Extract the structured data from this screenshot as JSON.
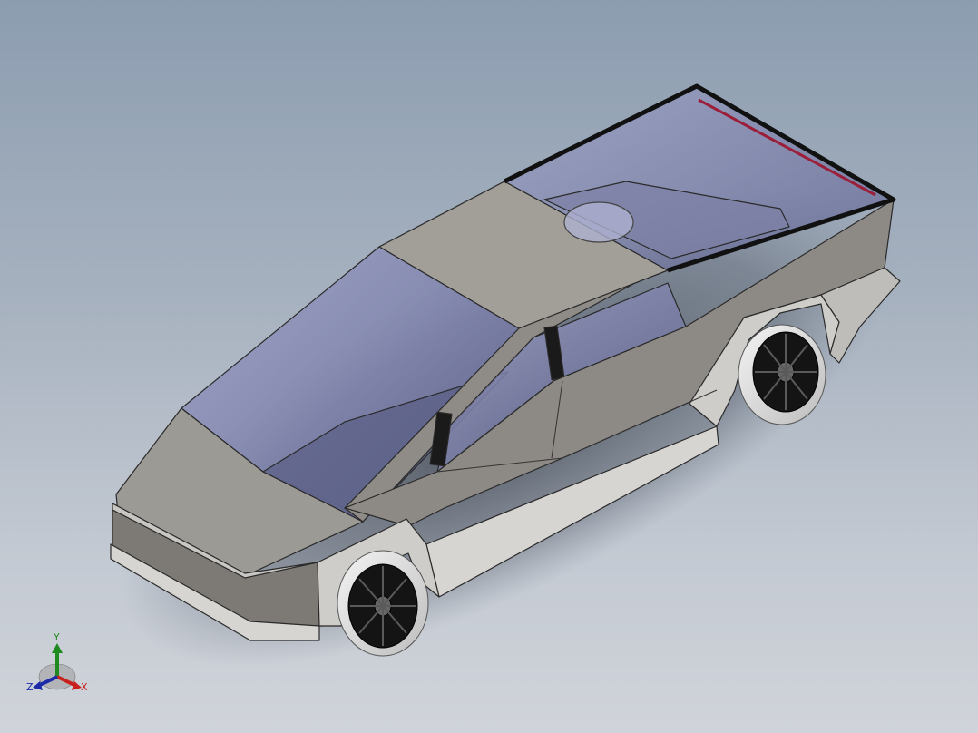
{
  "viewport": {
    "background_top": "#8c9db0",
    "background_bottom": "#d0d4da"
  },
  "model": {
    "body_color": "#a3a19c",
    "glass_color": "#6f73a3",
    "tire_color": "#d9d9d9",
    "hub_color": "#111111",
    "tailgate_accent": "#9b1f3a"
  },
  "triad": {
    "x_label": "X",
    "y_label": "Y",
    "z_label": "Z",
    "x_color": "#c8201c",
    "y_color": "#1f8a1f",
    "z_color": "#1c2aa8"
  }
}
